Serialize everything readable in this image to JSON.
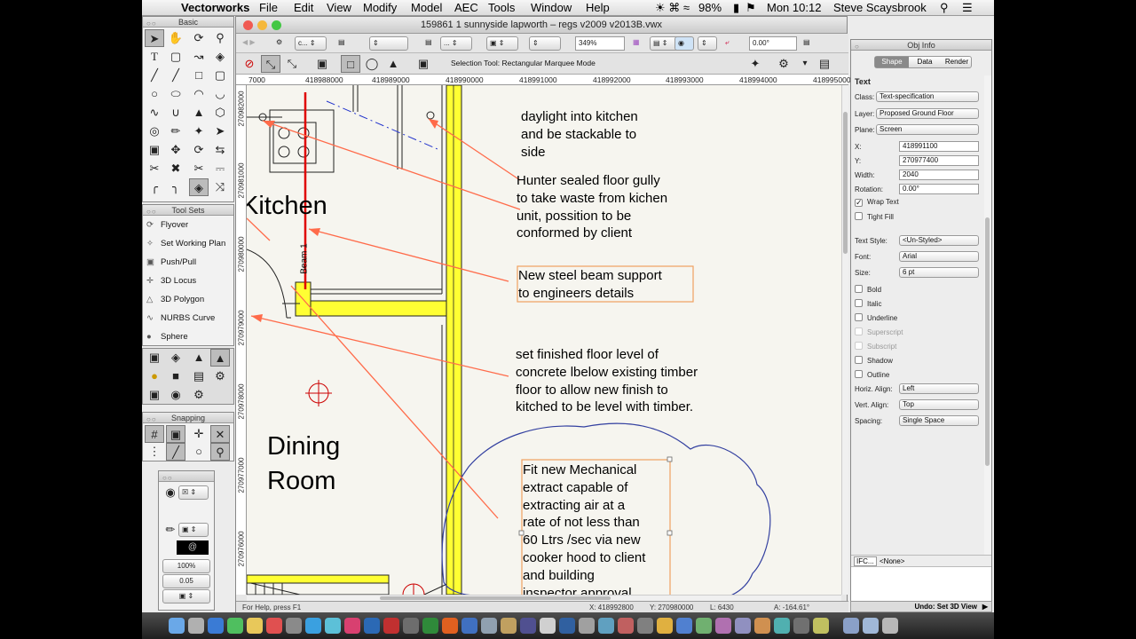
{
  "menubar": {
    "apple": "",
    "app": "Vectorworks",
    "items": [
      "File",
      "Edit",
      "View",
      "Modify",
      "Model",
      "AEC",
      "Tools",
      "Window",
      "Help"
    ],
    "battery": "98%",
    "time": "Mon 10:12",
    "user": "Steve Scaysbrook"
  },
  "palettes": {
    "basic_title": "Basic",
    "toolsets_title": "Tool Sets",
    "toolset_items": [
      "Flyover",
      "Set Working Plan",
      "Push/Pull",
      "3D Locus",
      "3D Polygon",
      "NURBS Curve",
      "Sphere"
    ],
    "snapping_title": "Snapping",
    "attr_zoom": "100%",
    "attr_line": "0.05"
  },
  "window": {
    "title": "159861 1 sunnyside lapworth – regs v2009 v2013B.vwx",
    "zoom": "349%",
    "angle": "0.00°",
    "mode_text": "Selection Tool: Rectangular Marquee Mode",
    "ruler_h": [
      "7000",
      "418988000",
      "418989000",
      "418990000",
      "418991000",
      "418992000",
      "418993000",
      "418994000",
      "418995000"
    ],
    "ruler_v": [
      "270982000",
      "270981000",
      "270980000",
      "270979000",
      "270978000",
      "270977000",
      "270976000"
    ]
  },
  "drawing": {
    "rooms": [
      "Kitchen",
      "Dining\nRoom"
    ],
    "beam_label": "Beam 1",
    "notes": [
      "daylight into kitchen\nand be stackable to\nside",
      "Hunter sealed floor gully\nto take waste from kichen\nunit, possition to be\nconformed by client",
      "New steel beam support\nto engineers details",
      "set finished floor level of\nconcrete lbelow existing timber\nfloor to allow new finish to\nkitched to be level with timber.",
      "Fit new Mechanical\nextract capable of\nextracting air at a\nrate of not less than\n60 Ltrs /sec via new\ncooker hood to client\nand building\ninspector approval"
    ]
  },
  "status": {
    "help": "For Help, press F1",
    "x": "X: 418992800",
    "y": "Y: 270980000",
    "l": "L: 6430",
    "a": "A: -164.61°",
    "undo": "Undo: Set 3D View"
  },
  "obj_info": {
    "title": "Obj Info",
    "tabs": [
      "Shape",
      "Data",
      "Render"
    ],
    "heading": "Text",
    "fields": [
      {
        "label": "Class:",
        "value": "Text-specification",
        "pop": true
      },
      {
        "label": "Layer:",
        "value": "Proposed Ground Floor",
        "pop": true
      },
      {
        "label": "Plane:",
        "value": "Screen",
        "pop": true
      },
      {
        "label": "X:",
        "value": "418991100",
        "pop": false
      },
      {
        "label": "Y:",
        "value": "270977400",
        "pop": false
      },
      {
        "label": "Width:",
        "value": "2040",
        "pop": false
      },
      {
        "label": "Rotation:",
        "value": "0.00°",
        "pop": false
      }
    ],
    "wrap_text": "Wrap Text",
    "tight_fill": "Tight Fill",
    "fields2": [
      {
        "label": "Text Style:",
        "value": "<Un-Styled>"
      },
      {
        "label": "Font:",
        "value": "Arial"
      },
      {
        "label": "Size:",
        "value": "6 pt"
      }
    ],
    "styles": [
      "Bold",
      "Italic",
      "Underline",
      "Superscript",
      "Subscript",
      "Shadow",
      "Outline"
    ],
    "fields3": [
      {
        "label": "Horiz. Align:",
        "value": "Left"
      },
      {
        "label": "Vert. Align:",
        "value": "Top"
      },
      {
        "label": "Spacing:",
        "value": "Single Space"
      }
    ],
    "ifc_label": "IFC...",
    "ifc_value": "<None>"
  },
  "colors": {
    "beam": "#ffff33",
    "annot": "#ff6b4a",
    "selection": "#f0a060",
    "cloud": "#3340a0"
  }
}
